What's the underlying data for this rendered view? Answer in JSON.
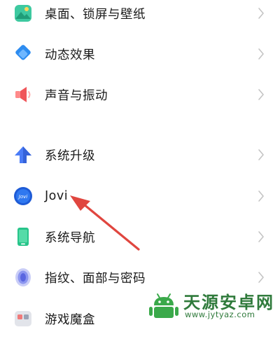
{
  "settings_list": {
    "items": [
      {
        "label": "桌面、锁屏与壁纸",
        "icon": "wallpaper-icon"
      },
      {
        "label": "动态效果",
        "icon": "motion-effects-icon"
      },
      {
        "label": "声音与振动",
        "icon": "speaker-icon"
      },
      {
        "label": "系统升级",
        "icon": "upgrade-arrow-icon"
      },
      {
        "label": "Jovi",
        "icon": "jovi-icon"
      },
      {
        "label": "系统导航",
        "icon": "phone-navigation-icon"
      },
      {
        "label": "指纹、面部与密码",
        "icon": "fingerprint-icon"
      },
      {
        "label": "游戏魔盒",
        "icon": "game-box-icon"
      }
    ]
  },
  "watermark": {
    "title": "天源安卓网",
    "url": "www.jytyaz.com"
  },
  "colors": {
    "annotation_arrow": "#e0463f",
    "chevron": "#c4c4c4",
    "watermark": "#2f7a3b"
  }
}
